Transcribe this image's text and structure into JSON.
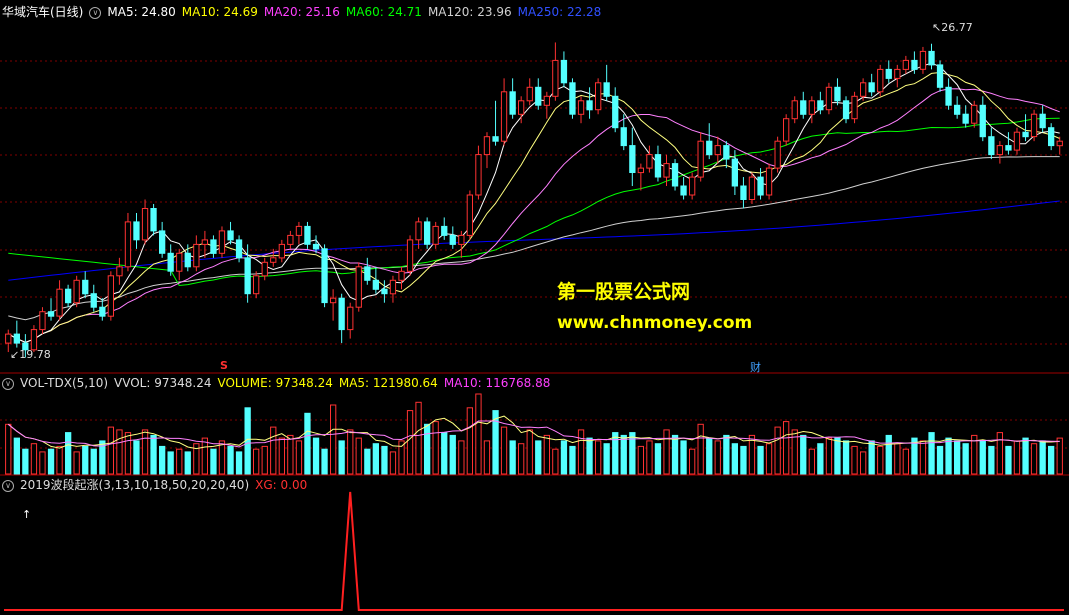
{
  "colors": {
    "up": "#ff3232",
    "down": "#54ffff",
    "ma5": "#ffff80",
    "ma10": "#ff80ff",
    "ma20": "#ff80ff",
    "ma60": "#00ff00",
    "ma120": "#d0d0d0",
    "ma250": "#0000ff",
    "xg": "#ff2020",
    "grid": "#800000"
  },
  "main_header": {
    "title": "华域汽车(日线)",
    "ma5": "MA5: 24.80",
    "ma10": "MA10: 24.69",
    "ma20": "MA20: 25.16",
    "ma60": "MA60: 24.71",
    "ma120": "MA120: 23.96",
    "ma250": "MA250: 22.28"
  },
  "vol_header": {
    "name": "VOL-TDX(5,10)",
    "vvol": "VVOL: 97348.24",
    "volume": "VOLUME: 97348.24",
    "ma5": "MA5: 121980.64",
    "ma10": "MA10: 116768.88"
  },
  "ind_header": {
    "name": "2019波段起涨(3,13,10,18,50,20,20,40)",
    "xg": "XG: 0.00"
  },
  "labels": {
    "high": "26.77",
    "low": "19.78",
    "mark_s": "S",
    "mark_cai": "财",
    "arrow": "↑"
  },
  "watermark": {
    "line1": "第一股票公式网",
    "line2": "www.chnmoney.com"
  },
  "chart_data": [
    {
      "type": "candlestick",
      "title": "华域汽车(日线)",
      "ylim": [
        19.5,
        27.3
      ],
      "annotations": [
        {
          "label": "26.77",
          "type": "high"
        },
        {
          "label": "19.78",
          "type": "low"
        }
      ],
      "candles": [
        [
          20.1,
          20.4,
          19.9,
          20.3
        ],
        [
          20.3,
          20.6,
          20.0,
          20.1
        ],
        [
          20.1,
          20.3,
          19.78,
          19.95
        ],
        [
          19.95,
          20.5,
          19.9,
          20.4
        ],
        [
          20.4,
          20.9,
          20.3,
          20.8
        ],
        [
          20.8,
          21.1,
          20.6,
          20.7
        ],
        [
          20.7,
          21.5,
          20.6,
          21.3
        ],
        [
          21.3,
          21.4,
          20.9,
          21.0
        ],
        [
          21.0,
          21.6,
          20.9,
          21.5
        ],
        [
          21.5,
          21.7,
          21.1,
          21.2
        ],
        [
          21.2,
          21.4,
          20.8,
          20.9
        ],
        [
          20.9,
          21.1,
          20.6,
          20.7
        ],
        [
          20.7,
          21.7,
          20.6,
          21.6
        ],
        [
          21.6,
          22.0,
          21.4,
          21.8
        ],
        [
          21.8,
          23.0,
          21.7,
          22.8
        ],
        [
          22.8,
          23.0,
          22.2,
          22.4
        ],
        [
          22.4,
          23.3,
          22.3,
          23.1
        ],
        [
          23.1,
          23.2,
          22.5,
          22.6
        ],
        [
          22.6,
          22.8,
          22.0,
          22.1
        ],
        [
          22.1,
          22.3,
          21.6,
          21.7
        ],
        [
          21.7,
          22.2,
          21.5,
          22.1
        ],
        [
          22.1,
          22.3,
          21.7,
          21.8
        ],
        [
          21.8,
          22.5,
          21.7,
          22.3
        ],
        [
          22.3,
          22.6,
          22.0,
          22.4
        ],
        [
          22.4,
          22.5,
          22.0,
          22.1
        ],
        [
          22.1,
          22.7,
          22.0,
          22.6
        ],
        [
          22.6,
          22.8,
          22.3,
          22.4
        ],
        [
          22.4,
          22.5,
          21.9,
          22.0
        ],
        [
          22.0,
          22.3,
          21.0,
          21.2
        ],
        [
          21.2,
          21.7,
          21.1,
          21.6
        ],
        [
          21.6,
          22.0,
          21.5,
          21.9
        ],
        [
          21.9,
          22.2,
          21.8,
          22.0
        ],
        [
          22.0,
          22.4,
          21.9,
          22.3
        ],
        [
          22.3,
          22.6,
          22.2,
          22.5
        ],
        [
          22.5,
          22.8,
          22.3,
          22.7
        ],
        [
          22.7,
          22.8,
          22.2,
          22.3
        ],
        [
          22.3,
          22.5,
          22.1,
          22.2
        ],
        [
          22.2,
          22.3,
          20.9,
          21.0
        ],
        [
          21.0,
          21.3,
          20.6,
          21.1
        ],
        [
          21.1,
          21.2,
          20.1,
          20.4
        ],
        [
          20.4,
          21.0,
          20.2,
          20.9
        ],
        [
          20.9,
          21.9,
          20.8,
          21.8
        ],
        [
          21.8,
          22.0,
          21.4,
          21.5
        ],
        [
          21.5,
          21.8,
          21.2,
          21.3
        ],
        [
          21.3,
          21.5,
          21.0,
          21.2
        ],
        [
          21.2,
          21.6,
          21.0,
          21.5
        ],
        [
          21.5,
          21.8,
          21.3,
          21.7
        ],
        [
          21.7,
          22.5,
          21.6,
          22.4
        ],
        [
          22.4,
          22.9,
          22.2,
          22.8
        ],
        [
          22.8,
          22.9,
          22.2,
          22.3
        ],
        [
          22.3,
          22.8,
          22.2,
          22.7
        ],
        [
          22.7,
          22.9,
          22.4,
          22.5
        ],
        [
          22.5,
          22.7,
          22.2,
          22.3
        ],
        [
          22.3,
          22.6,
          22.0,
          22.5
        ],
        [
          22.5,
          23.5,
          22.4,
          23.4
        ],
        [
          23.4,
          24.5,
          23.3,
          24.3
        ],
        [
          24.3,
          24.8,
          24.0,
          24.7
        ],
        [
          24.7,
          25.5,
          24.5,
          24.6
        ],
        [
          24.6,
          26.0,
          24.5,
          25.7
        ],
        [
          25.7,
          26.0,
          25.1,
          25.2
        ],
        [
          25.2,
          25.6,
          25.0,
          25.5
        ],
        [
          25.5,
          26.0,
          25.4,
          25.8
        ],
        [
          25.8,
          26.0,
          25.3,
          25.4
        ],
        [
          25.4,
          25.7,
          25.1,
          25.6
        ],
        [
          25.6,
          26.8,
          25.5,
          26.4
        ],
        [
          26.4,
          26.6,
          25.8,
          25.9
        ],
        [
          25.9,
          26.0,
          25.1,
          25.2
        ],
        [
          25.2,
          25.6,
          25.0,
          25.5
        ],
        [
          25.5,
          25.8,
          25.1,
          25.3
        ],
        [
          25.3,
          26.0,
          25.2,
          25.9
        ],
        [
          25.9,
          26.3,
          25.5,
          25.6
        ],
        [
          25.6,
          25.8,
          24.8,
          24.9
        ],
        [
          24.9,
          25.2,
          24.4,
          24.5
        ],
        [
          24.5,
          24.9,
          23.6,
          23.9
        ],
        [
          23.9,
          24.1,
          23.5,
          24.0
        ],
        [
          24.0,
          24.5,
          23.9,
          24.3
        ],
        [
          24.3,
          24.5,
          23.7,
          23.8
        ],
        [
          23.8,
          24.3,
          23.6,
          24.1
        ],
        [
          24.1,
          24.2,
          23.5,
          23.6
        ],
        [
          23.6,
          23.8,
          23.3,
          23.4
        ],
        [
          23.4,
          23.9,
          23.3,
          23.8
        ],
        [
          23.8,
          24.8,
          23.7,
          24.6
        ],
        [
          24.6,
          25.0,
          24.2,
          24.3
        ],
        [
          24.3,
          24.7,
          24.1,
          24.5
        ],
        [
          24.5,
          24.6,
          24.0,
          24.2
        ],
        [
          24.2,
          24.4,
          23.4,
          23.6
        ],
        [
          23.6,
          23.8,
          23.1,
          23.3
        ],
        [
          23.3,
          23.9,
          23.2,
          23.8
        ],
        [
          23.8,
          24.0,
          23.3,
          23.4
        ],
        [
          23.4,
          24.1,
          23.3,
          24.0
        ],
        [
          24.0,
          24.7,
          23.9,
          24.6
        ],
        [
          24.6,
          25.2,
          24.5,
          25.1
        ],
        [
          25.1,
          25.6,
          25.0,
          25.5
        ],
        [
          25.5,
          25.7,
          25.1,
          25.2
        ],
        [
          25.2,
          25.6,
          25.0,
          25.5
        ],
        [
          25.5,
          25.7,
          25.2,
          25.3
        ],
        [
          25.3,
          25.9,
          25.2,
          25.8
        ],
        [
          25.8,
          26.0,
          25.4,
          25.5
        ],
        [
          25.5,
          25.6,
          25.0,
          25.1
        ],
        [
          25.1,
          25.7,
          25.0,
          25.6
        ],
        [
          25.6,
          26.0,
          25.5,
          25.9
        ],
        [
          25.9,
          26.1,
          25.6,
          25.7
        ],
        [
          25.7,
          26.3,
          25.6,
          26.2
        ],
        [
          26.2,
          26.4,
          25.9,
          26.0
        ],
        [
          26.0,
          26.3,
          25.8,
          26.2
        ],
        [
          26.2,
          26.5,
          26.1,
          26.4
        ],
        [
          26.4,
          26.6,
          26.1,
          26.2
        ],
        [
          26.2,
          26.7,
          26.1,
          26.6
        ],
        [
          26.6,
          26.77,
          26.2,
          26.3
        ],
        [
          26.3,
          26.4,
          25.7,
          25.8
        ],
        [
          25.8,
          26.0,
          25.3,
          25.4
        ],
        [
          25.4,
          25.6,
          25.1,
          25.2
        ],
        [
          25.2,
          25.4,
          24.9,
          25.0
        ],
        [
          25.0,
          25.5,
          24.9,
          25.4
        ],
        [
          25.4,
          25.6,
          24.6,
          24.7
        ],
        [
          24.7,
          24.9,
          24.2,
          24.3
        ],
        [
          24.3,
          24.6,
          24.1,
          24.5
        ],
        [
          24.5,
          24.8,
          24.3,
          24.4
        ],
        [
          24.4,
          24.9,
          24.3,
          24.8
        ],
        [
          24.8,
          25.2,
          24.6,
          24.7
        ],
        [
          24.7,
          25.3,
          24.6,
          25.2
        ],
        [
          25.2,
          25.4,
          24.8,
          24.9
        ],
        [
          24.9,
          25.0,
          24.4,
          24.5
        ],
        [
          24.5,
          24.7,
          24.3,
          24.6
        ]
      ]
    },
    {
      "type": "bar",
      "title": "VOL-TDX(5,10)",
      "values": [
        18,
        13,
        9,
        11,
        8,
        9,
        10,
        15,
        8,
        10,
        9,
        12,
        17,
        16,
        15,
        12,
        16,
        14,
        10,
        8,
        9,
        8,
        11,
        13,
        9,
        12,
        10,
        8,
        24,
        9,
        10,
        17,
        13,
        14,
        12,
        22,
        13,
        9,
        25,
        12,
        16,
        13,
        9,
        11,
        10,
        8,
        12,
        23,
        26,
        18,
        19,
        15,
        14,
        12,
        24,
        29,
        12,
        23,
        17,
        12,
        11,
        16,
        12,
        14,
        9,
        12,
        10,
        16,
        13,
        12,
        11,
        15,
        14,
        15,
        10,
        12,
        11,
        16,
        14,
        12,
        9,
        18,
        13,
        12,
        14,
        11,
        10,
        14,
        10,
        11,
        17,
        19,
        16,
        14,
        9,
        11,
        13,
        13,
        12,
        10,
        8,
        12,
        10,
        14,
        11,
        9,
        13,
        12,
        15,
        10,
        13,
        12,
        11,
        14,
        12,
        10,
        15,
        10,
        12,
        13,
        11,
        12,
        10,
        13
      ],
      "ma5_label": "MA5: 121980.64",
      "ma10_label": "MA10: 116768.88"
    },
    {
      "type": "line",
      "title": "2019波段起涨(3,13,10,18,50,20,20,40)",
      "series": [
        {
          "name": "XG",
          "spike_index": 40,
          "baseline": 0,
          "peak": 1
        }
      ]
    }
  ]
}
